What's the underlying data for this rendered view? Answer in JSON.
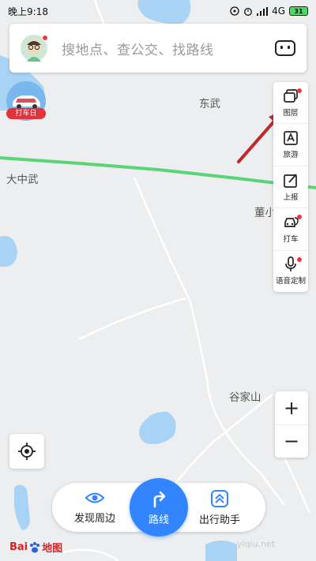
{
  "status_bar": {
    "time": "晚上9:18",
    "network": "4G",
    "battery": "31"
  },
  "search": {
    "placeholder": "搜地点、查公交、找路线"
  },
  "promo": {
    "label": "打车日"
  },
  "toolbar": {
    "items": [
      {
        "label": "图层",
        "icon": "layers-icon",
        "dot": true
      },
      {
        "label": "旅游",
        "icon": "travel-icon",
        "dot": false
      },
      {
        "label": "上报",
        "icon": "report-icon",
        "dot": false
      },
      {
        "label": "打车",
        "icon": "taxi-icon",
        "dot": true
      },
      {
        "label": "语音定制",
        "icon": "microphone-icon",
        "dot": true
      }
    ]
  },
  "map_labels": {
    "dongwu": "东武",
    "dazhongwu": "大中武",
    "dongxiao": "董小",
    "gujiashan": "谷家山"
  },
  "zoom": {
    "in": "+",
    "out": "−"
  },
  "bottom_bar": {
    "discover": "发现周边",
    "route": "路线",
    "travel_assistant": "出行助手"
  },
  "logo": {
    "text_left": "Bai",
    "text_right": "地图"
  },
  "watermark": "yiqiu.net",
  "colors": {
    "accent": "#3385ff",
    "road_green": "#4bd068",
    "water": "#a9d3f5",
    "annotation_arrow": "#c0282a"
  }
}
